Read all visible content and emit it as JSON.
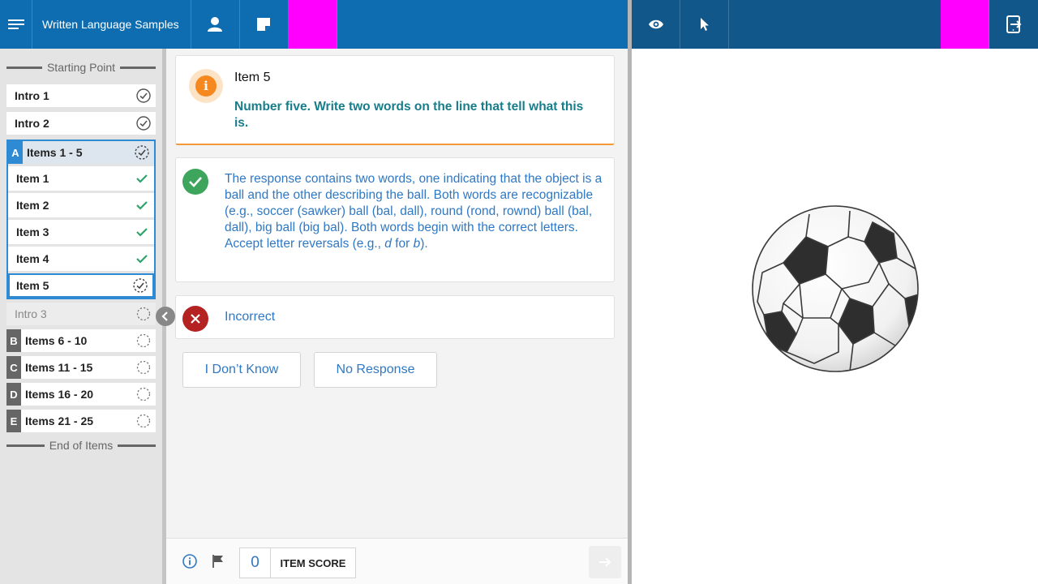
{
  "header": {
    "title": "Written Language Samples",
    "icons": [
      "menu-icon",
      "person-icon",
      "note-icon",
      "eye-icon",
      "cursor-icon",
      "exit-tablet-icon"
    ],
    "accent": "#0e6db0",
    "right_accent": "#12578a"
  },
  "sidebar": {
    "start_label": "Starting Point",
    "end_label": "End of Items",
    "intro1": "Intro 1",
    "intro2": "Intro 2",
    "group_a": {
      "letter": "A",
      "label": "Items 1 - 5"
    },
    "items": [
      "Item 1",
      "Item 2",
      "Item 3",
      "Item 4",
      "Item 5"
    ],
    "intro3": "Intro 3",
    "group_b": {
      "letter": "B",
      "label": "Items 6 - 10"
    },
    "group_c": {
      "letter": "C",
      "label": "Items 11 - 15"
    },
    "group_d": {
      "letter": "D",
      "label": "Items 16 - 20"
    },
    "group_e": {
      "letter": "E",
      "label": "Items 21 - 25"
    }
  },
  "main": {
    "item_title": "Item 5",
    "prompt": "Number five. Write two words on the line that tell what this is.",
    "correct_text_1": "The response contains two words, one indicating that the object is a ball and the other describing the ball. Both words are recognizable (e.g., soccer (sawker) ball (bal, dall), round (rond, rownd) ball (bal, dall), big ball (big bal). Both words begin with the correct letters. Accept letter reversals (e.g., ",
    "correct_em_1": "d",
    "correct_text_2": " for ",
    "correct_em_2": "b",
    "correct_text_3": ").",
    "incorrect_label": "Incorrect",
    "idk_label": "I Don’t Know",
    "no_response_label": "No Response"
  },
  "footer": {
    "score": "0",
    "score_label": "ITEM SCORE"
  },
  "stimulus": {
    "image": "soccer-ball"
  }
}
